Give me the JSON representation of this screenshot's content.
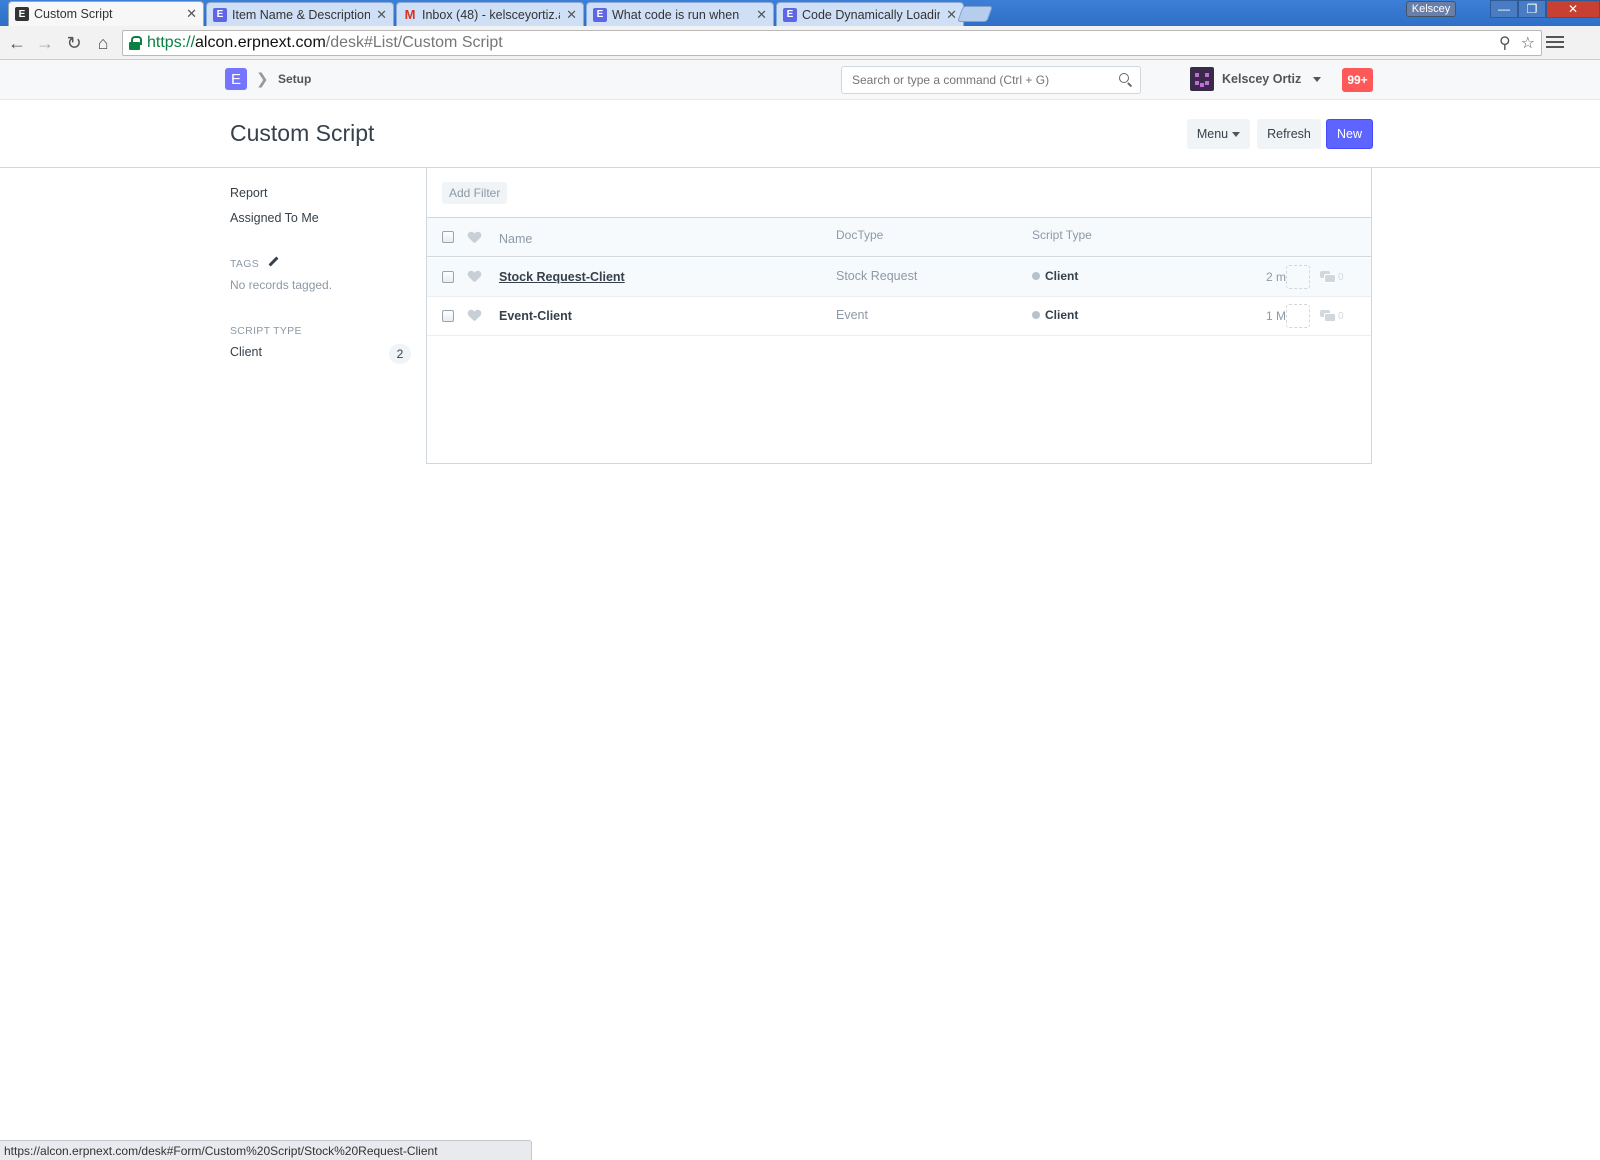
{
  "browser": {
    "tabs": [
      {
        "icon": "E",
        "title": "Custom Script",
        "active": true
      },
      {
        "icon": "E",
        "title": "Item Name & Description"
      },
      {
        "icon": "M",
        "title": "Inbox (48) - kelsceyortiz.a"
      },
      {
        "icon": "E",
        "title": "What code is run when"
      },
      {
        "icon": "E",
        "title": "Code Dynamically Loading"
      }
    ],
    "close_glyph": "✕",
    "profile_name": "Kelscey",
    "url": {
      "scheme": "https://",
      "host": "alcon.erpnext.com",
      "path": "/desk#List/Custom Script"
    },
    "status_url": "https://alcon.erpnext.com/desk#Form/Custom%20Script/Stock%20Request-Client"
  },
  "navbar": {
    "logo_letter": "E",
    "breadcrumb": "Setup",
    "search_placeholder": "Search or type a command (Ctrl + G)",
    "user_name": "Kelscey Ortiz",
    "notifications": "99+"
  },
  "page": {
    "title": "Custom Script",
    "buttons": {
      "menu": "Menu",
      "refresh": "Refresh",
      "new": "New"
    }
  },
  "sidebar": {
    "links": [
      "Report",
      "Assigned To Me"
    ],
    "tags_heading": "TAGS",
    "tags_empty": "No records tagged.",
    "script_type_heading": "SCRIPT TYPE",
    "script_type_item": {
      "label": "Client",
      "count": "2"
    }
  },
  "list": {
    "add_filter": "Add Filter",
    "columns": {
      "name": "Name",
      "doctype": "DocType",
      "script_type": "Script Type"
    },
    "rows": [
      {
        "name": "Stock Request-Client",
        "doctype": "Stock Request",
        "script_type": "Client",
        "modified": "2 m",
        "comments": "0"
      },
      {
        "name": "Event-Client",
        "doctype": "Event",
        "script_type": "Client",
        "modified": "1 M",
        "comments": "0"
      }
    ]
  },
  "colors": {
    "primary": "#5e64ff",
    "notification": "#ff5858",
    "text": "#36414c",
    "muted": "#8d99a6"
  }
}
